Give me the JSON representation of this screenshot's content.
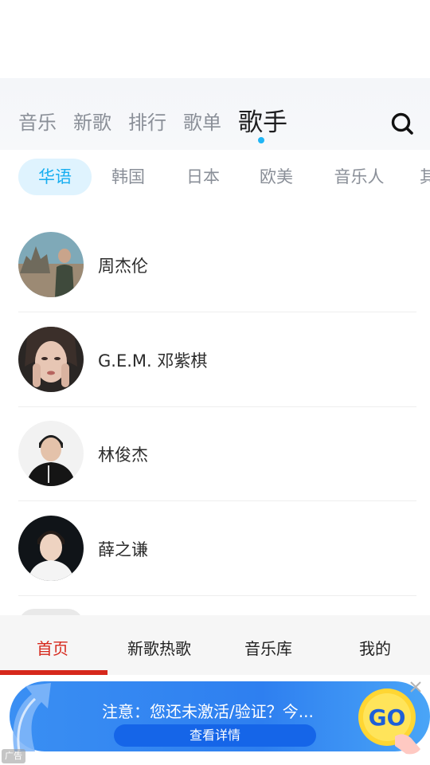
{
  "top_tabs": {
    "items": [
      "音乐",
      "新歌",
      "排行",
      "歌单",
      "歌手"
    ],
    "active_index": 4
  },
  "filters": {
    "items": [
      "华语",
      "韩国",
      "日本",
      "欧美",
      "音乐人",
      "其"
    ],
    "active_index": 0
  },
  "singers": [
    {
      "name": "周杰伦"
    },
    {
      "name": "G.E.M. 邓紫棋"
    },
    {
      "name": "林俊杰"
    },
    {
      "name": "薛之谦"
    }
  ],
  "bottom_nav": {
    "items": [
      "首页",
      "新歌热歌",
      "音乐库",
      "我的"
    ],
    "active_index": 0
  },
  "ad": {
    "text": "注意：您还未激活/验证？今...",
    "button_label": "查看详情",
    "go_label": "GO",
    "tag_label": "广告"
  },
  "colors": {
    "accent_blue": "#20b5f5",
    "nav_active_red": "#d6281c",
    "ad_blue": "#2e7ff0"
  }
}
